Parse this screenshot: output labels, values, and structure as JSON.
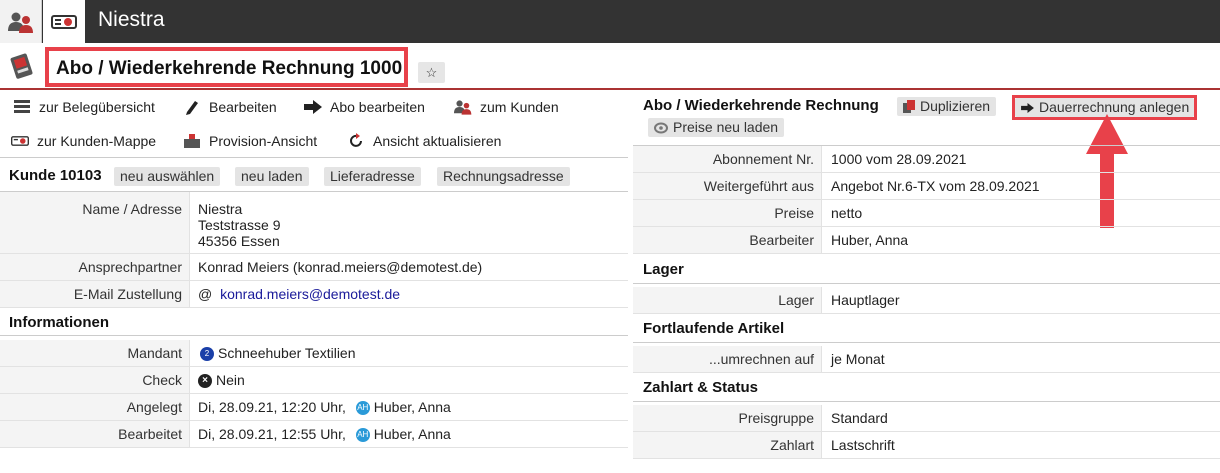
{
  "topbar": {
    "title": "Niestra"
  },
  "header": {
    "title": "Abo / Wiederkehrende Rechnung 1000",
    "star_glyph": "☆"
  },
  "actions": {
    "beleg": "zur Belegübersicht",
    "bearbeiten": "Bearbeiten",
    "abo": "Abo bearbeiten",
    "kunde": "zum Kunden",
    "mappe": "zur Kunden-Mappe",
    "provision": "Provision-Ansicht",
    "refresh": "Ansicht aktualisieren"
  },
  "customer": {
    "heading": "Kunde 10103",
    "buttons": [
      "neu auswählen",
      "neu laden",
      "Lieferadresse",
      "Rechnungsadresse"
    ],
    "rows": {
      "name_label": "Name / Adresse",
      "name_lines": [
        "Niestra",
        "Teststrasse 9",
        "45356 Essen"
      ],
      "contact_label": "Ansprechpartner",
      "contact_value": "Konrad Meiers (konrad.meiers@demotest.de)",
      "email_label": "E-Mail Zustellung",
      "email_at": "@",
      "email_value": "konrad.meiers@demotest.de"
    }
  },
  "info": {
    "heading": "Informationen",
    "mandant_label": "Mandant",
    "mandant_badge": "2",
    "mandant_value": "Schneehuber Textilien",
    "check_label": "Check",
    "check_value": "Nein",
    "created_label": "Angelegt",
    "created_value": "Di, 28.09.21, 12:20 Uhr,",
    "created_badge": "AH",
    "created_user": "Huber, Anna",
    "edited_label": "Bearbeitet",
    "edited_value": "Di, 28.09.21, 12:55 Uhr,",
    "edited_badge": "AH",
    "edited_user": "Huber, Anna"
  },
  "right": {
    "heading": "Abo / Wiederkehrende Rechnung",
    "duplicate": "Duplizieren",
    "dauer": "Dauerrechnung anlegen",
    "reload_prices": "Preise neu laden",
    "rows": [
      {
        "label": "Abonnement Nr.",
        "value": "1000 vom 28.09.2021"
      },
      {
        "label": "Weitergeführt aus",
        "value": "Angebot Nr.6-TX vom 28.09.2021"
      },
      {
        "label": "Preise",
        "value": "netto"
      },
      {
        "label": "Bearbeiter",
        "value": "Huber, Anna"
      }
    ],
    "lager_heading": "Lager",
    "lager_label": "Lager",
    "lager_value": "Hauptlager",
    "fort_heading": "Fortlaufende Artikel",
    "fort_label": "...umrechnen auf",
    "fort_value": "je Monat",
    "zahl_heading": "Zahlart & Status",
    "preisgruppe_label": "Preisgruppe",
    "preisgruppe_value": "Standard",
    "zahlart_label": "Zahlart",
    "zahlart_value": "Lastschrift"
  },
  "colors": {
    "highlight": "#e8414a",
    "topbar": "#333333"
  }
}
